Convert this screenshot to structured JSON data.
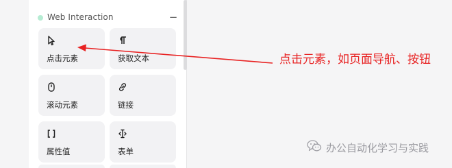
{
  "section": {
    "title": "Web Interaction",
    "collapse_symbol": "−",
    "accent": "#b6ecd3"
  },
  "cards": [
    {
      "label": "点击元素",
      "icon": "cursor-pointer-icon"
    },
    {
      "label": "获取文本",
      "icon": "pilcrow-icon"
    },
    {
      "label": "滚动元素",
      "icon": "mouse-icon"
    },
    {
      "label": "链接",
      "icon": "link-icon"
    },
    {
      "label": "属性值",
      "icon": "brackets-icon"
    },
    {
      "label": "表单",
      "icon": "text-cursor-icon"
    }
  ],
  "annotation": {
    "text": "点击元素，如页面导航、按钮",
    "color": "#e82222"
  },
  "watermark": {
    "text": "办公自动化学习与实践",
    "icon": "wechat-icon"
  }
}
